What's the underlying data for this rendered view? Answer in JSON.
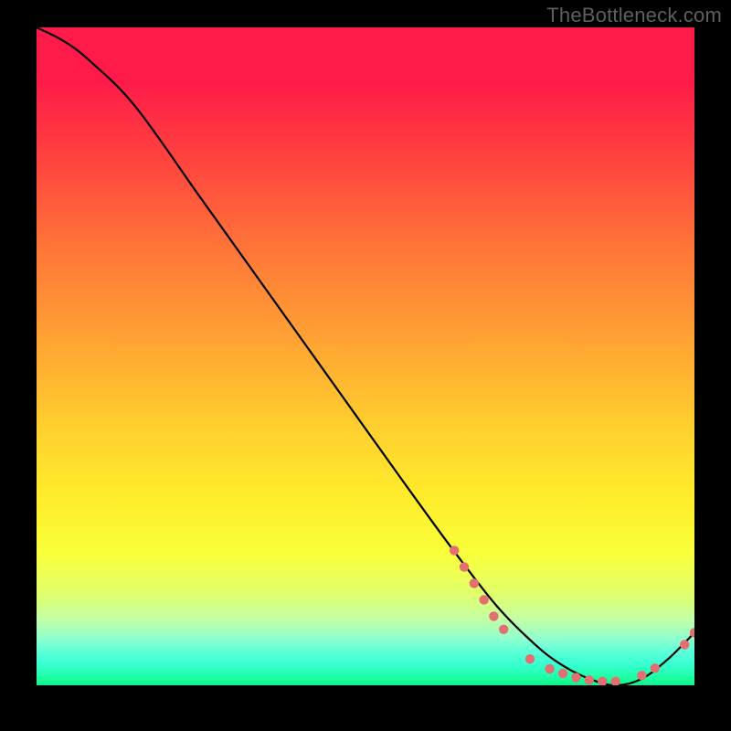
{
  "watermark": "TheBottleneck.com",
  "chart_data": {
    "type": "line",
    "title": "",
    "xlabel": "",
    "ylabel": "",
    "xlim": [
      0,
      100
    ],
    "ylim": [
      0,
      100
    ],
    "grid": false,
    "legend": false,
    "background": "rainbow-gradient",
    "series": [
      {
        "name": "bottleneck-curve",
        "color": "#000000",
        "x": [
          0,
          4,
          8,
          15,
          25,
          35,
          45,
          55,
          63,
          70,
          76,
          80,
          84,
          88,
          92,
          96,
          100
        ],
        "y": [
          100,
          98,
          95,
          88,
          74,
          60,
          46,
          32,
          21,
          12,
          6,
          3,
          1,
          0,
          1,
          4,
          8
        ]
      }
    ],
    "points": [
      {
        "name": "cluster-left-1",
        "x": 63.5,
        "y": 20.5
      },
      {
        "name": "cluster-left-2",
        "x": 65.0,
        "y": 18.0
      },
      {
        "name": "cluster-left-3",
        "x": 66.5,
        "y": 15.5
      },
      {
        "name": "cluster-left-4",
        "x": 68.0,
        "y": 13.0
      },
      {
        "name": "cluster-left-5",
        "x": 69.5,
        "y": 10.5
      },
      {
        "name": "cluster-left-6",
        "x": 71.0,
        "y": 8.5
      },
      {
        "name": "trough-1",
        "x": 75.0,
        "y": 4.0
      },
      {
        "name": "trough-2",
        "x": 78.0,
        "y": 2.5
      },
      {
        "name": "trough-3",
        "x": 80.0,
        "y": 1.8
      },
      {
        "name": "trough-4",
        "x": 82.0,
        "y": 1.2
      },
      {
        "name": "trough-5",
        "x": 84.0,
        "y": 0.8
      },
      {
        "name": "trough-6",
        "x": 86.0,
        "y": 0.6
      },
      {
        "name": "trough-7",
        "x": 88.0,
        "y": 0.6
      },
      {
        "name": "rise-1",
        "x": 92.0,
        "y": 1.5
      },
      {
        "name": "rise-2",
        "x": 94.0,
        "y": 2.6
      },
      {
        "name": "rise-3",
        "x": 98.5,
        "y": 6.2
      },
      {
        "name": "rise-4",
        "x": 100.0,
        "y": 8.0
      }
    ],
    "annotations": [
      {
        "name": "trough-label",
        "text": "",
        "x": 82,
        "y": 2.4
      }
    ]
  }
}
